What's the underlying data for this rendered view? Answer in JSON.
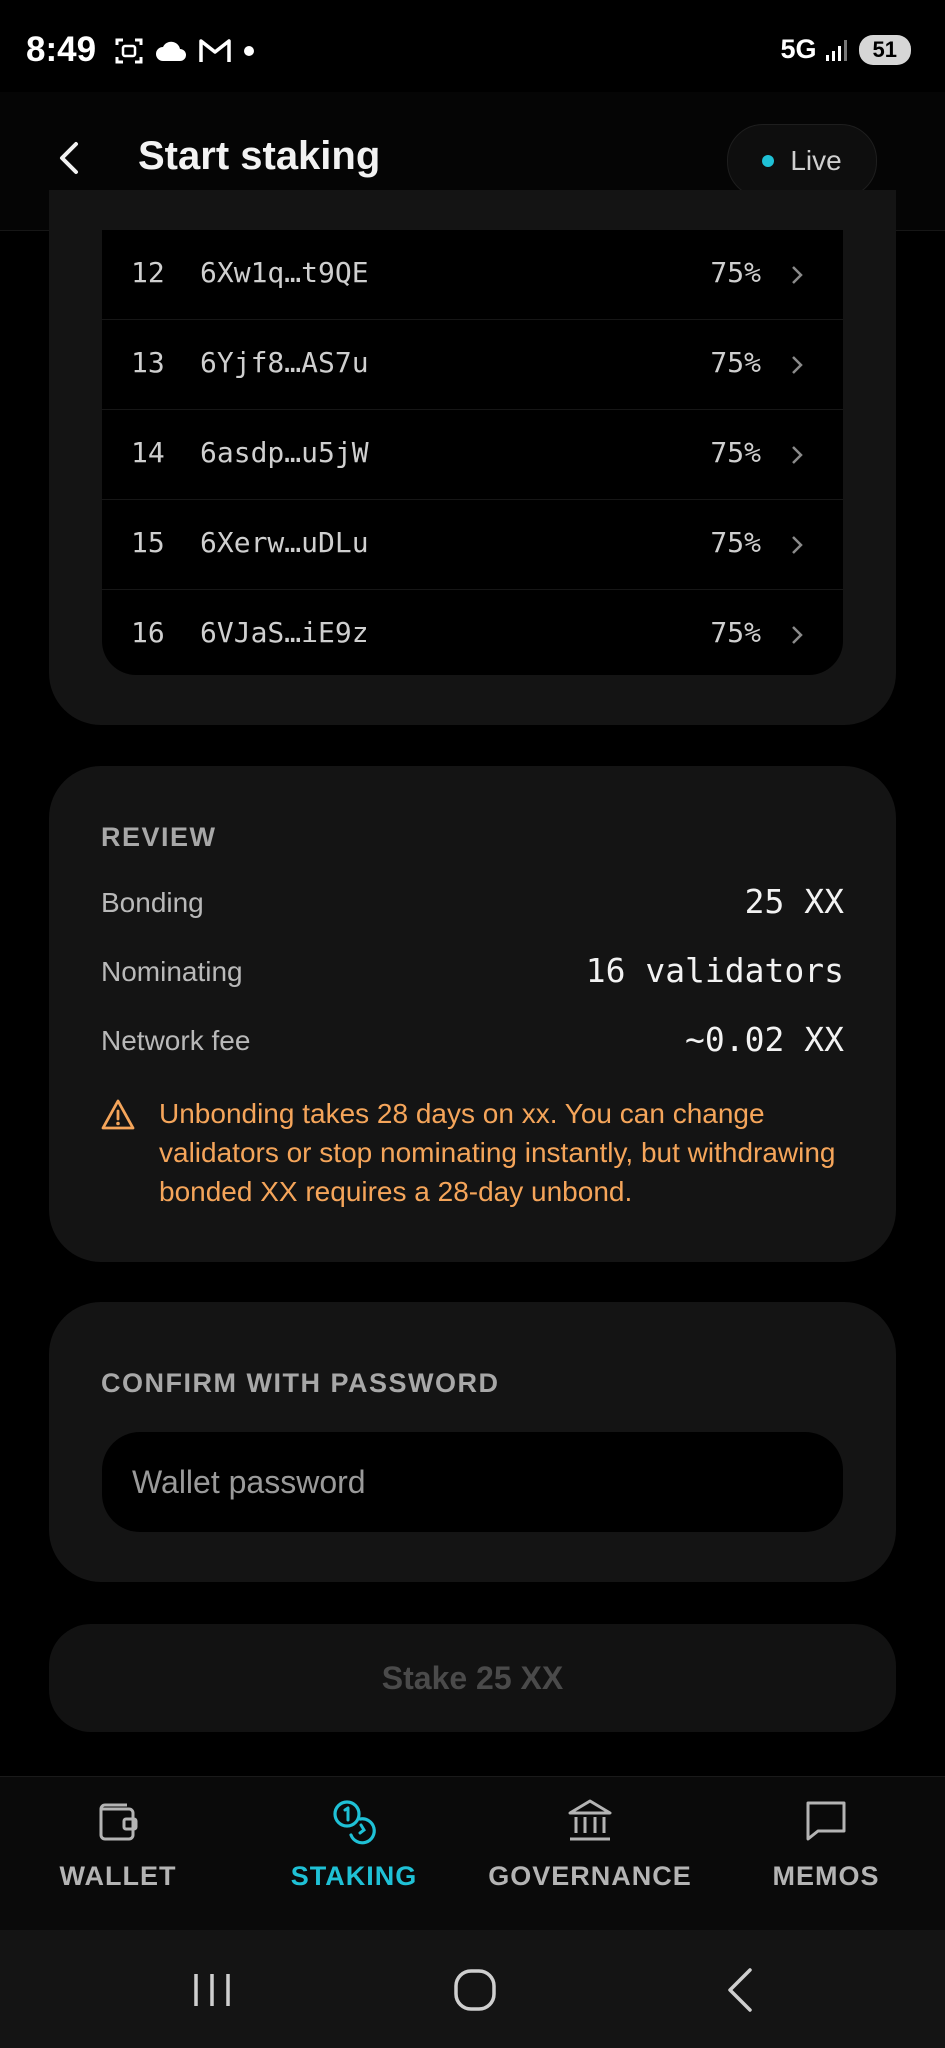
{
  "status_bar": {
    "time": "8:49",
    "network": "5G",
    "battery": "51",
    "icons": [
      "screenshot-icon",
      "cloud-icon",
      "gmail-icon",
      "notification-dot-icon",
      "signal-icon"
    ]
  },
  "header": {
    "title": "Start staking",
    "live_label": "Live",
    "live_color": "#1fc1d6"
  },
  "validators": [
    {
      "index": "12",
      "address": "6Xw1q…t9QE",
      "commission": "75%"
    },
    {
      "index": "13",
      "address": "6Yjf8…AS7u",
      "commission": "75%"
    },
    {
      "index": "14",
      "address": "6asdp…u5jW",
      "commission": "75%"
    },
    {
      "index": "15",
      "address": "6Xerw…uDLu",
      "commission": "75%"
    },
    {
      "index": "16",
      "address": "6VJaS…iE9z",
      "commission": "75%"
    }
  ],
  "review": {
    "heading": "REVIEW",
    "rows": [
      {
        "label": "Bonding",
        "value": "25 XX"
      },
      {
        "label": "Nominating",
        "value": "16 validators"
      },
      {
        "label": "Network fee",
        "value": "~0.02 XX"
      }
    ],
    "warning": "Unbonding takes 28 days on xx. You can change validators or stop nominating instantly, but withdrawing bonded XX requires a 28-day unbond.",
    "warning_color": "#f5a55a"
  },
  "password": {
    "heading": "CONFIRM WITH PASSWORD",
    "placeholder": "Wallet password",
    "value": ""
  },
  "stake_button": {
    "label": "Stake 25 XX",
    "disabled": true
  },
  "bottom_nav": [
    {
      "label": "WALLET",
      "icon": "wallet-icon",
      "active": false
    },
    {
      "label": "STAKING",
      "icon": "staking-coins-icon",
      "active": true
    },
    {
      "label": "GOVERNANCE",
      "icon": "bank-icon",
      "active": false
    },
    {
      "label": "MEMOS",
      "icon": "chat-icon",
      "active": false
    }
  ],
  "colors": {
    "accent": "#1fc1d6",
    "background": "#000000",
    "card": "#141414"
  }
}
